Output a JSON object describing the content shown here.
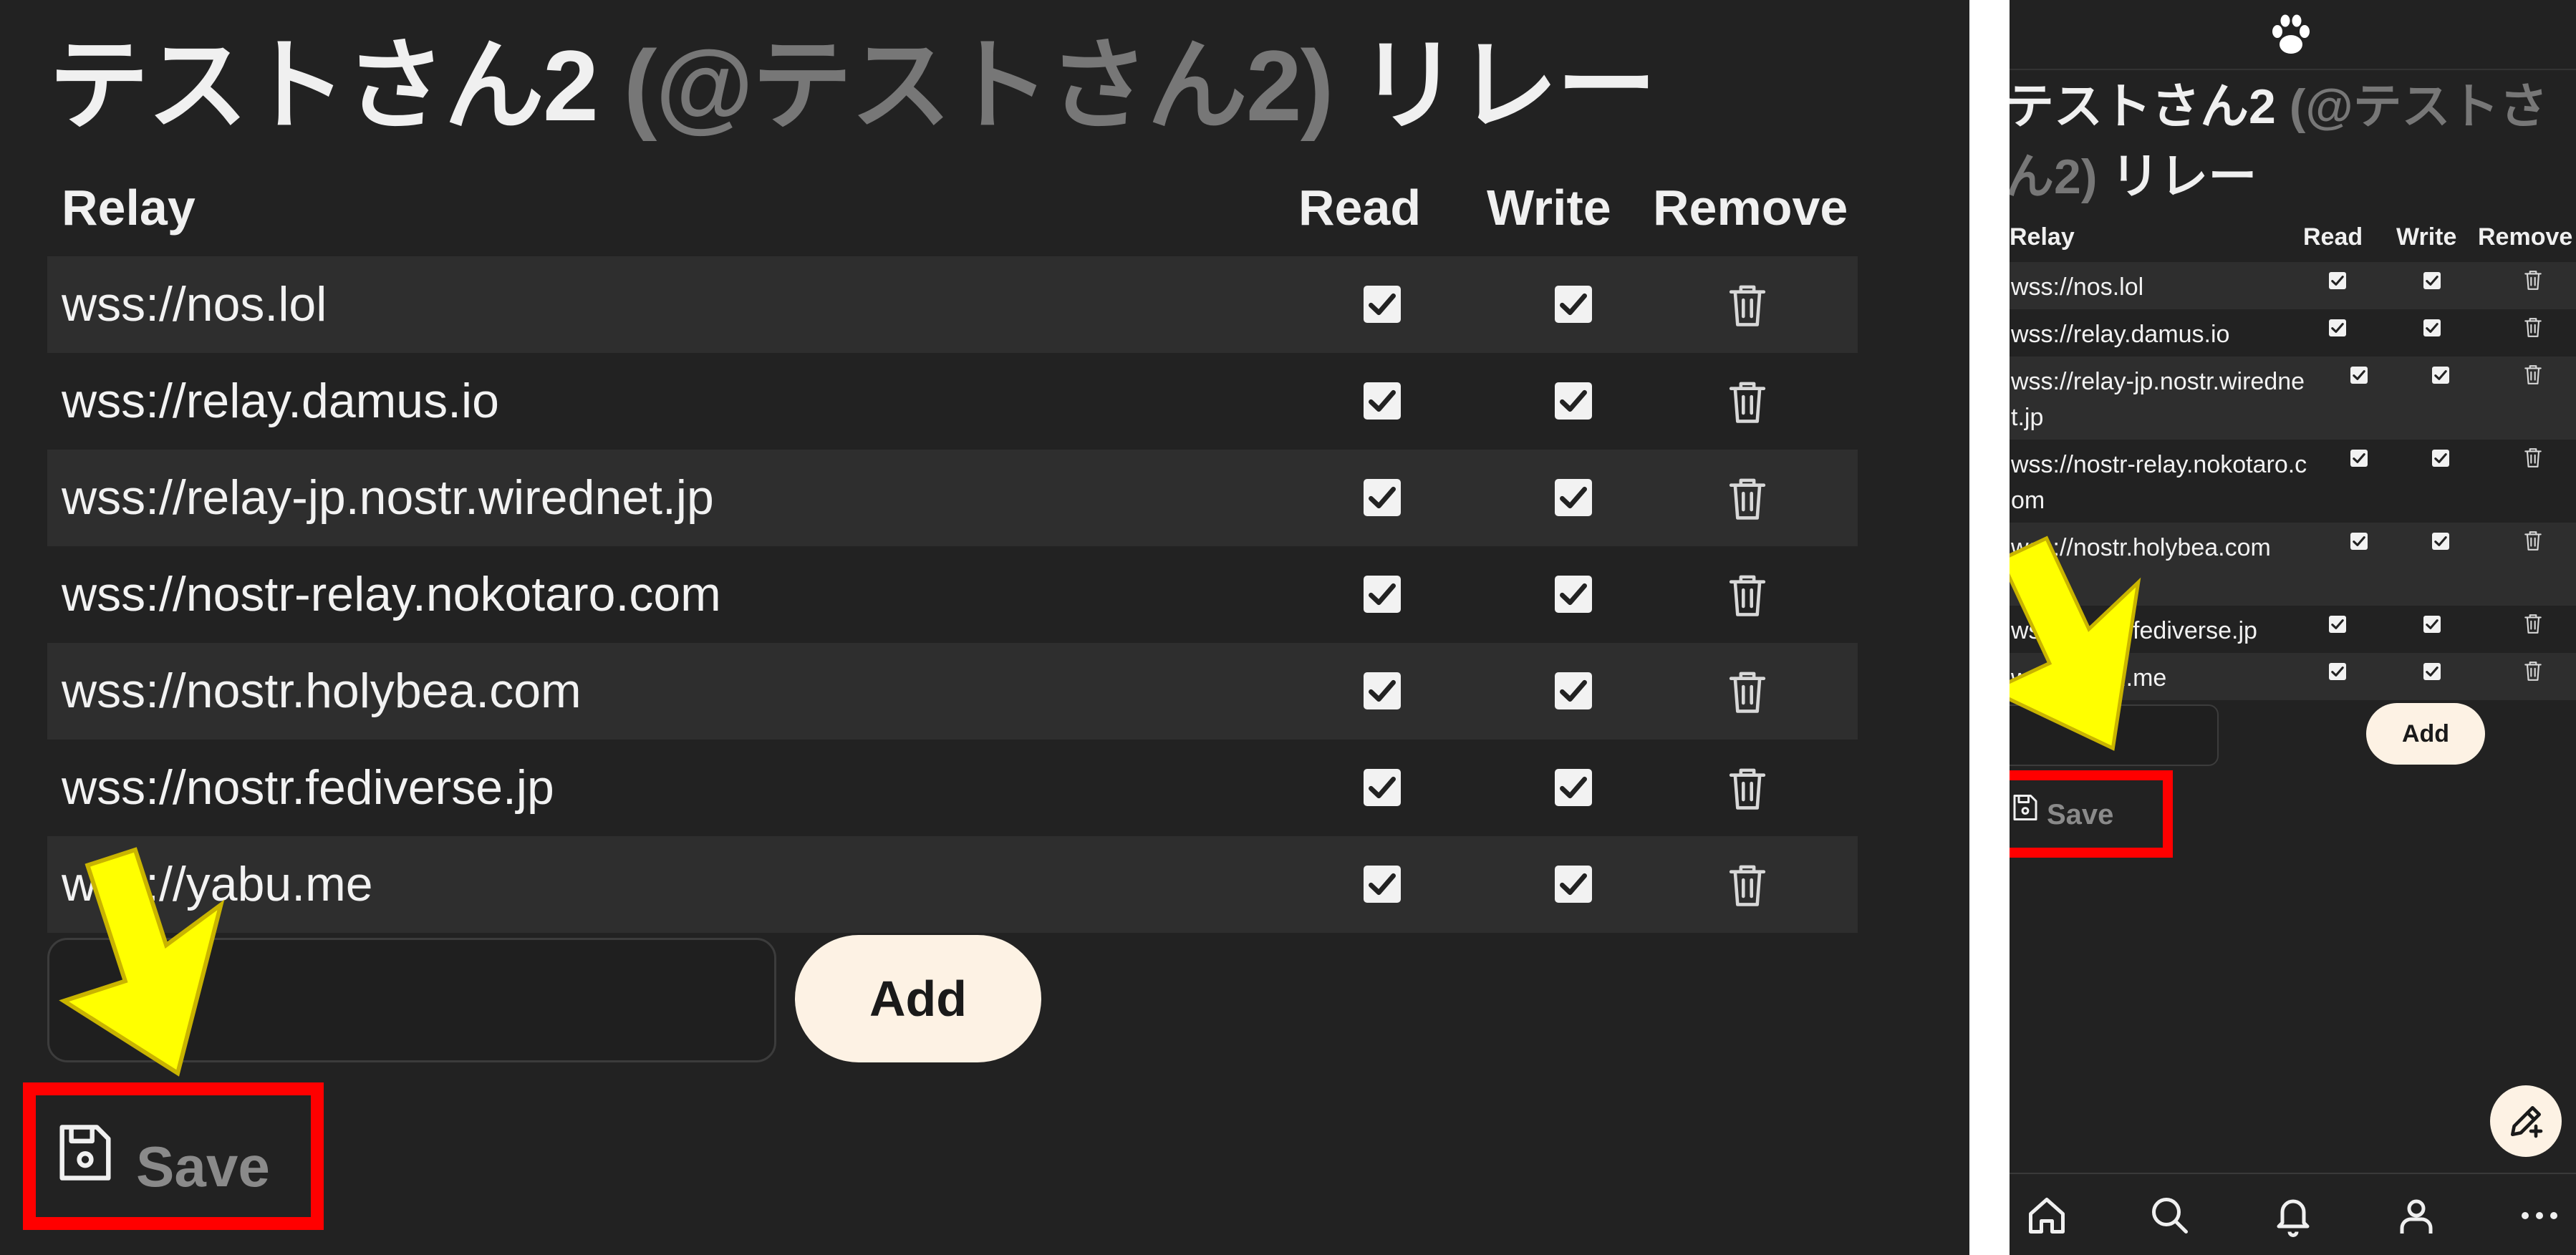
{
  "left": {
    "title": "テストさん2",
    "handle": "(@テストさん2)",
    "title_suffix": "リレー",
    "columns": {
      "relay": "Relay",
      "read": "Read",
      "write": "Write",
      "remove": "Remove"
    },
    "relays": [
      {
        "url": "wss://nos.lol",
        "read": true,
        "write": true
      },
      {
        "url": "wss://relay.damus.io",
        "read": true,
        "write": true
      },
      {
        "url": "wss://relay-jp.nostr.wirednet.jp",
        "read": true,
        "write": true
      },
      {
        "url": "wss://nostr-relay.nokotaro.com",
        "read": true,
        "write": true
      },
      {
        "url": "wss://nostr.holybea.com",
        "read": true,
        "write": true
      },
      {
        "url": "wss://nostr.fediverse.jp",
        "read": true,
        "write": true
      },
      {
        "url": "wss://yabu.me",
        "read": true,
        "write": true
      }
    ],
    "add_input_value": "",
    "add_label": "Add",
    "save_label": "Save"
  },
  "right": {
    "title": "テストさん2",
    "handle": "(@テストさん2)",
    "title_suffix": "リレー",
    "columns": {
      "relay": "Relay",
      "read": "Read",
      "write": "Write",
      "remove": "Remove"
    },
    "relays": [
      {
        "url": "wss://nos.lol",
        "read": true,
        "write": true
      },
      {
        "url": "wss://relay.damus.io",
        "read": true,
        "write": true
      },
      {
        "url": "wss://relay-jp.nostr.wirednet.jp",
        "read": true,
        "write": true
      },
      {
        "url": "wss://nostr-relay.nokotaro.com",
        "read": true,
        "write": true
      },
      {
        "url": "wss://nostr.holybea.com",
        "read": true,
        "write": true
      },
      {
        "url": "wss://nostr.fediverse.jp",
        "read": true,
        "write": true
      },
      {
        "url": "wss://yabu.me",
        "read": true,
        "write": true
      }
    ],
    "add_input_value": "",
    "add_label": "Add",
    "save_label": "Save",
    "nav": [
      "home-icon",
      "search-icon",
      "bell-icon",
      "person-icon",
      "more-icon"
    ]
  },
  "colors": {
    "background": "#222222",
    "row_alt": "#2e2e2e",
    "muted": "#777777",
    "button_bg": "#fdf2e4",
    "highlight": "#ff0000",
    "arrow": "#ffff00"
  }
}
